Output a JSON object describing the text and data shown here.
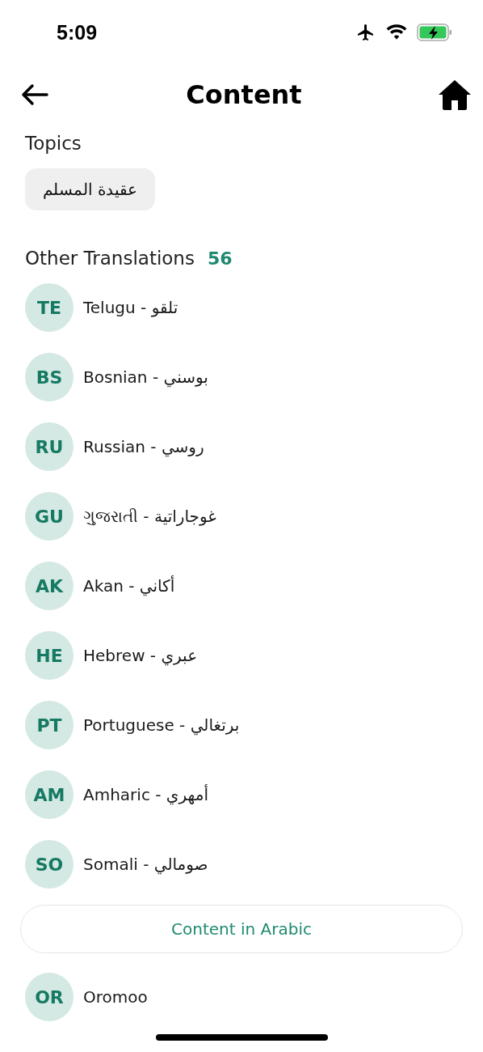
{
  "status_bar": {
    "time": "5:09"
  },
  "header": {
    "title": "Content"
  },
  "topics": {
    "heading": "Topics",
    "chips": [
      "عقيدة المسلم"
    ]
  },
  "translations": {
    "heading": "Other Translations",
    "count": "56",
    "items": [
      {
        "code": "TE",
        "label": "Telugu - تلقو"
      },
      {
        "code": "BS",
        "label": "Bosnian - بوسني"
      },
      {
        "code": "RU",
        "label": "Russian - روسي"
      },
      {
        "code": "GU",
        "label": "ગુજરાતી - غوجاراتية"
      },
      {
        "code": "AK",
        "label": "Akan - أكاني"
      },
      {
        "code": "HE",
        "label": "Hebrew - عبري"
      },
      {
        "code": "PT",
        "label": "Portuguese - برتغالي"
      },
      {
        "code": "AM",
        "label": "Amharic - أمهري"
      },
      {
        "code": "SO",
        "label": "Somali - صومالي"
      }
    ]
  },
  "arabic_button": "Content in Arabic",
  "more_items": [
    {
      "code": "OR",
      "label": "Oromoo"
    }
  ]
}
